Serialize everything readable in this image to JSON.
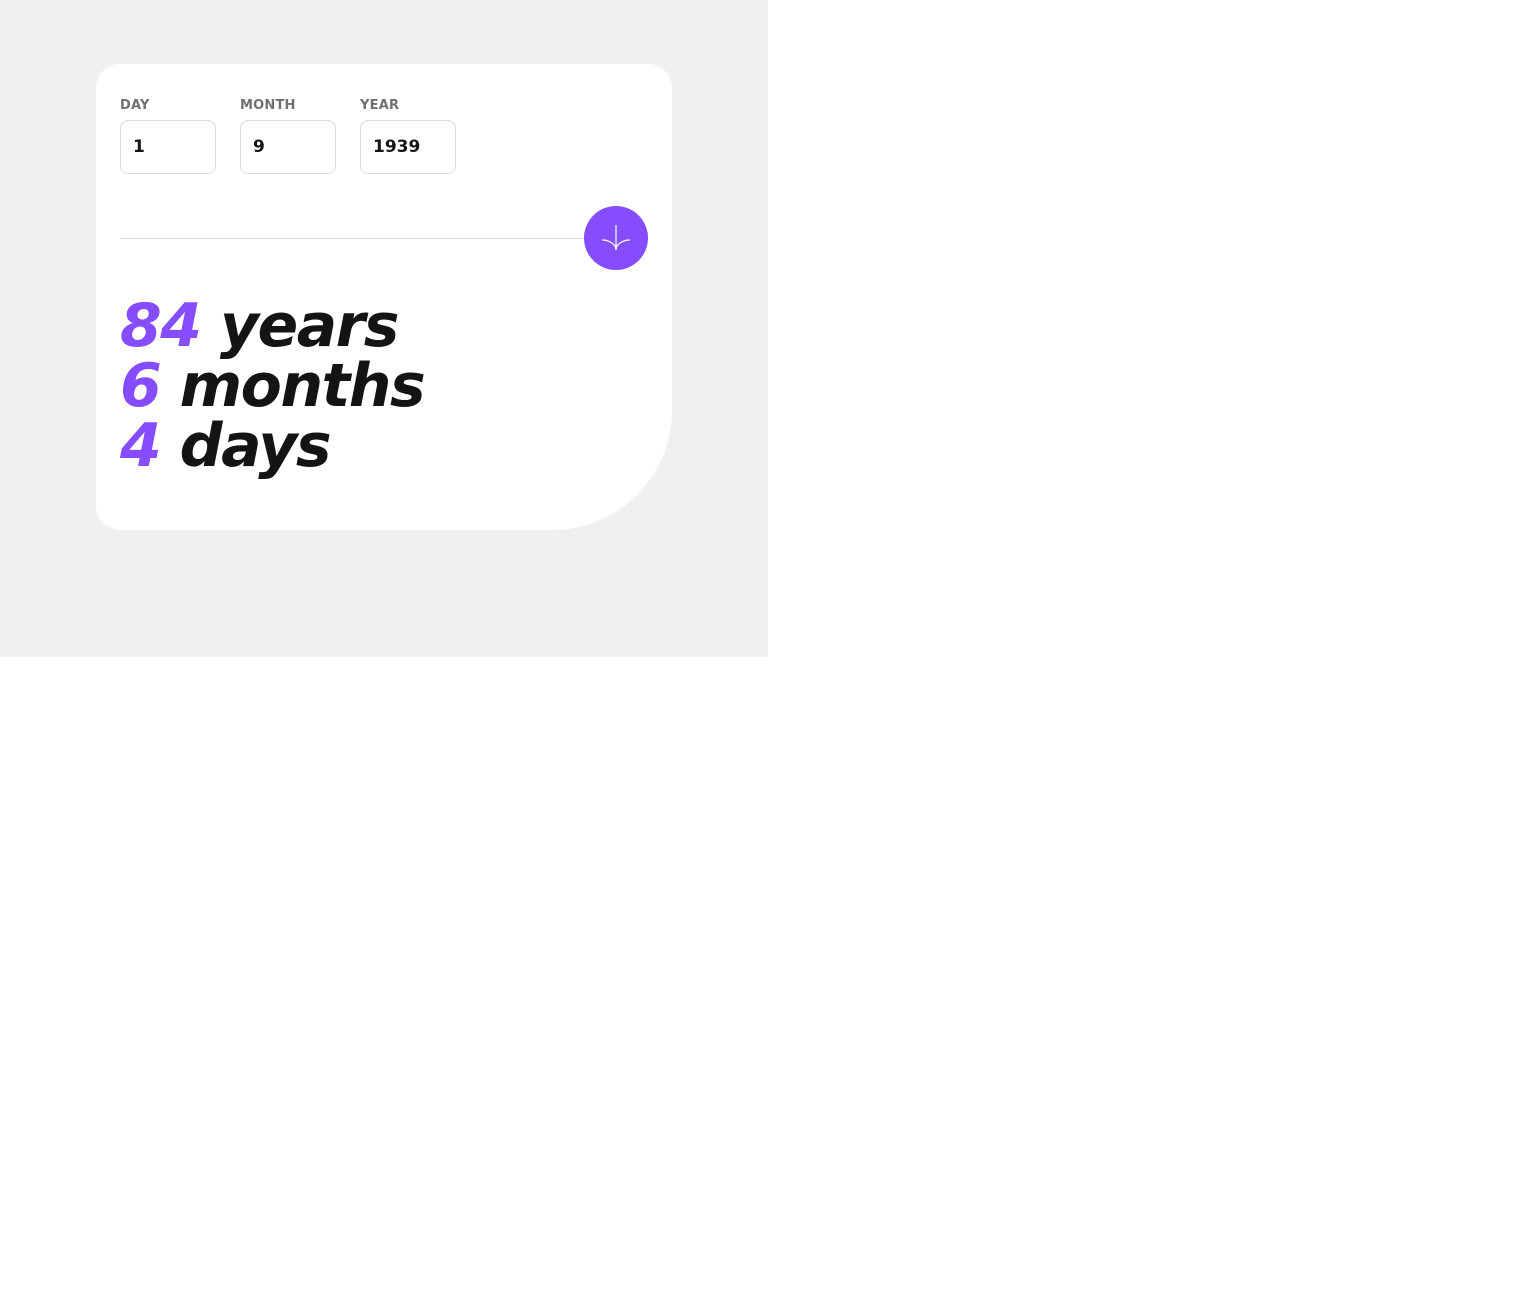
{
  "colors": {
    "accent": "#854dff",
    "text_dark": "#141414",
    "label_gray": "#716f6f",
    "background": "#f0f0f0",
    "card": "#ffffff"
  },
  "form": {
    "day": {
      "label": "DAY",
      "value": "1"
    },
    "month": {
      "label": "MONTH",
      "value": "9"
    },
    "year": {
      "label": "YEAR",
      "value": "1939"
    },
    "submit_icon": "arrow-down-icon"
  },
  "results": {
    "years": {
      "value": "84",
      "unit": "years"
    },
    "months": {
      "value": "6",
      "unit": "months"
    },
    "days": {
      "value": "4",
      "unit": "days"
    }
  }
}
